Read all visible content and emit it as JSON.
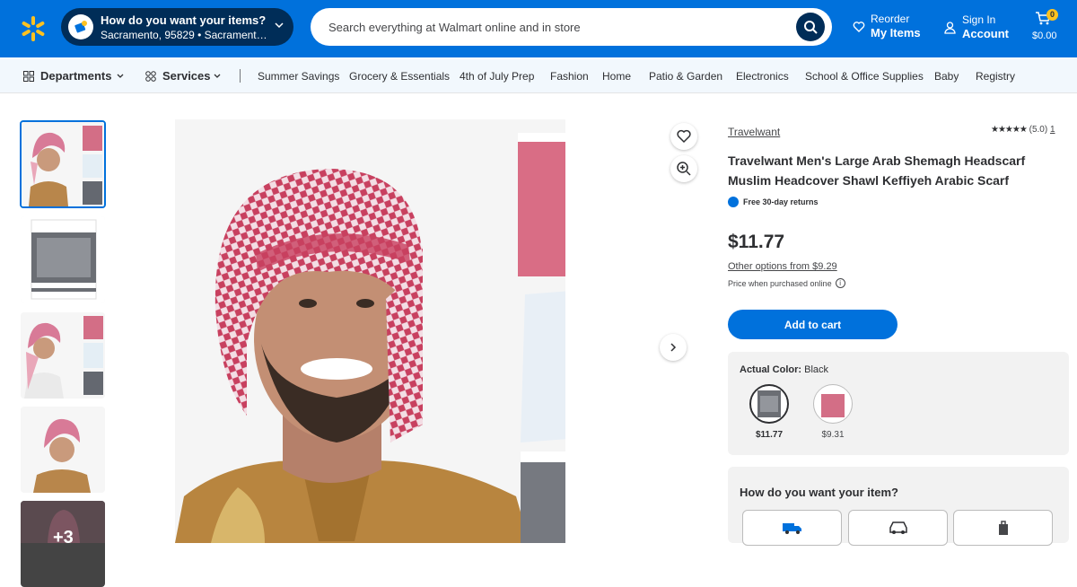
{
  "header": {
    "delivery_title": "How do you want your items?",
    "delivery_location": "Sacramento, 95829 • Sacramento Su...",
    "search_placeholder": "Search everything at Walmart online and in store",
    "reorder_top": "Reorder",
    "reorder_bottom": "My Items",
    "signin_top": "Sign In",
    "signin_bottom": "Account",
    "cart_count": "0",
    "cart_total": "$0.00"
  },
  "nav": {
    "departments": "Departments",
    "services": "Services",
    "links": [
      "Summer Savings",
      "Grocery & Essentials",
      "4th of July Prep",
      "Fashion",
      "Home",
      "Patio & Garden",
      "Electronics",
      "School & Office Supplies",
      "Baby",
      "Registry"
    ]
  },
  "gallery": {
    "more_count": "+3"
  },
  "product": {
    "seller": "Travelwant",
    "rating_text": "(5.0)",
    "review_count": "1",
    "title": "Travelwant Men's Large Arab Shemagh Headscarf Muslim Headcover Shawl Keffiyeh Arabic Scarf",
    "returns": "Free 30-day returns",
    "price": "$11.77",
    "other_options": "Other options from $9.29",
    "price_note": "Price when purchased online",
    "add_to_cart": "Add to cart",
    "color_label": "Actual Color:",
    "color_value": "Black",
    "swatches": [
      {
        "price": "$11.77"
      },
      {
        "price": "$9.31"
      }
    ],
    "how_label": "How do you want your item?"
  },
  "colors": {
    "brand_blue": "#0071dc",
    "dark_blue": "#002d58",
    "cart_yellow": "#ffc220"
  }
}
